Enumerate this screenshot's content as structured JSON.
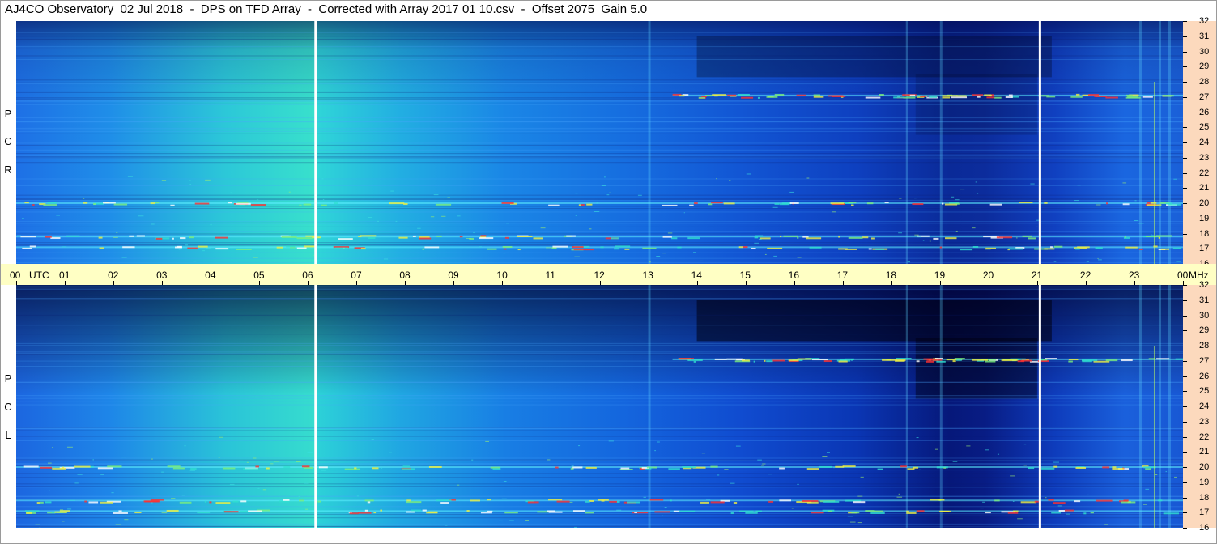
{
  "title": "AJ4CO Observatory  02 Jul 2018  -  DPS on TFD Array  -  Corrected with Array 2017 01 10.csv  -  Offset 2075  Gain 5.0",
  "polarizations": {
    "top": [
      "R",
      "C",
      "P"
    ],
    "bottom": [
      "L",
      "C",
      "P"
    ]
  },
  "time_axis": {
    "utc_label": "UTC",
    "mhz_label": "MHz",
    "hour_labels": [
      "00",
      "01",
      "02",
      "03",
      "04",
      "05",
      "06",
      "07",
      "08",
      "09",
      "10",
      "11",
      "12",
      "13",
      "14",
      "15",
      "16",
      "17",
      "18",
      "19",
      "20",
      "21",
      "22",
      "23",
      "00"
    ]
  },
  "chart_data": {
    "type": "heatmap",
    "title": "AJ4CO Observatory  02 Jul 2018  -  DPS on TFD Array  -  Corrected with Array 2017 01 10.csv  -  Offset 2075  Gain 5.0",
    "xlabel": "UTC",
    "ylabel": "MHz",
    "x_range_hours": [
      0,
      24
    ],
    "y_range_mhz": [
      16,
      32
    ],
    "y_ticks": [
      32,
      31,
      30,
      29,
      28,
      27,
      26,
      25,
      24,
      23,
      22,
      21,
      20,
      19,
      18,
      17,
      16
    ],
    "panels": [
      "RCP",
      "LCP"
    ],
    "white_vertical_markers_utc_hours": [
      6.15,
      21.05
    ],
    "colormap": [
      "#000033",
      "#0a2a98",
      "#1a66e0",
      "#2cc8d8",
      "#7cf07c",
      "#f0f040",
      "#ff3030"
    ],
    "persistent_signal_bands_mhz": [
      27.1,
      17.8,
      17.1,
      20.0
    ]
  },
  "colors": {
    "freq_scale_bg": "#fcd9bd",
    "time_axis_bg": "#ffffc4"
  }
}
